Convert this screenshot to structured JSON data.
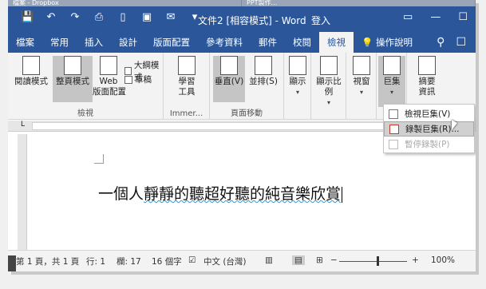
{
  "taskbar_tabs": [
    "檔案 - Dropbox",
    "PPT製作..."
  ],
  "qat": {
    "icons": [
      "save-icon",
      "undo-icon",
      "redo-icon",
      "print-preview-icon",
      "new-doc-icon",
      "save-disk-icon",
      "email-icon",
      "customize-icon"
    ]
  },
  "window": {
    "title": "文件2 [相容模式] - Word",
    "signin": "登入"
  },
  "tabs": [
    "檔案",
    "常用",
    "插入",
    "設計",
    "版面配置",
    "參考資料",
    "郵件",
    "校閱",
    "檢視"
  ],
  "tell_me": "操作說明",
  "ribbon": {
    "views": {
      "read": "閱讀模式",
      "print": "整頁模式",
      "web": "Web\n版面配置",
      "outline": "大綱模式",
      "draft": "草稿",
      "label": "檢視"
    },
    "immersive": {
      "learning": "學習\n工具",
      "label": "Immer..."
    },
    "page_move": {
      "vertical": "垂直(V)",
      "side": "並排(S)",
      "label": "頁面移動"
    },
    "show": "顯示",
    "zoom": "顯示比例",
    "window": "視窗",
    "macros": "巨集",
    "props": "摘要\n資訊"
  },
  "macro_menu": [
    {
      "label": "檢視巨集(V)",
      "state": "normal"
    },
    {
      "label": "錄製巨集(R)...",
      "state": "highlighted"
    },
    {
      "label": "暫停錄製(P)",
      "state": "disabled"
    }
  ],
  "document": {
    "pre": "一個人",
    "underlined": "靜靜的聽超好聽的純音樂欣賞"
  },
  "status": {
    "page": "第 1 頁，共 1 頁",
    "line": "行: 1",
    "col": "欄: 17",
    "words": "16 個字",
    "lang": "中文 (台灣)",
    "zoom": "100%"
  }
}
